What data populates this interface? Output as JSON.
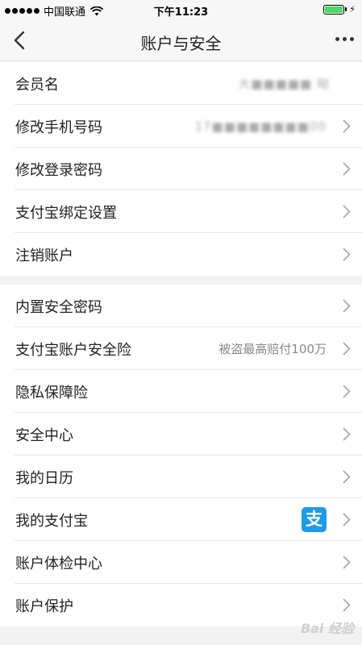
{
  "status_bar": {
    "carrier": "中国联通",
    "time": "下午11:23",
    "battery_level": 1.0
  },
  "nav": {
    "title": "账户与安全"
  },
  "group1": [
    {
      "label": "会员名",
      "value": "大■■■■■ 呦",
      "has_arrow": false
    },
    {
      "label": "修改手机号码",
      "value": "17■■■■■■■■00",
      "has_arrow": true
    },
    {
      "label": "修改登录密码",
      "value": "",
      "has_arrow": true
    },
    {
      "label": "支付宝绑定设置",
      "value": "",
      "has_arrow": true
    },
    {
      "label": "注销账户",
      "value": "",
      "has_arrow": true
    }
  ],
  "group2": [
    {
      "label": "内置安全密码",
      "value": "",
      "has_arrow": true
    },
    {
      "label": "支付宝账户安全险",
      "value": "被盗最高赔付100万",
      "has_arrow": true
    },
    {
      "label": "隐私保障险",
      "value": "",
      "has_arrow": true
    },
    {
      "label": "安全中心",
      "value": "",
      "has_arrow": true
    },
    {
      "label": "我的日历",
      "value": "",
      "has_arrow": true
    },
    {
      "label": "我的支付宝",
      "value": "",
      "icon": "alipay-icon",
      "icon_glyph": "支",
      "has_arrow": true
    },
    {
      "label": "账户体检中心",
      "value": "",
      "has_arrow": true
    },
    {
      "label": "账户保护",
      "value": "",
      "has_arrow": true
    }
  ],
  "watermark": "Bai 经验",
  "colors": {
    "background": "#f2f2f2",
    "alipay_blue": "#1a9cea",
    "battery_green": "#4cd964"
  }
}
